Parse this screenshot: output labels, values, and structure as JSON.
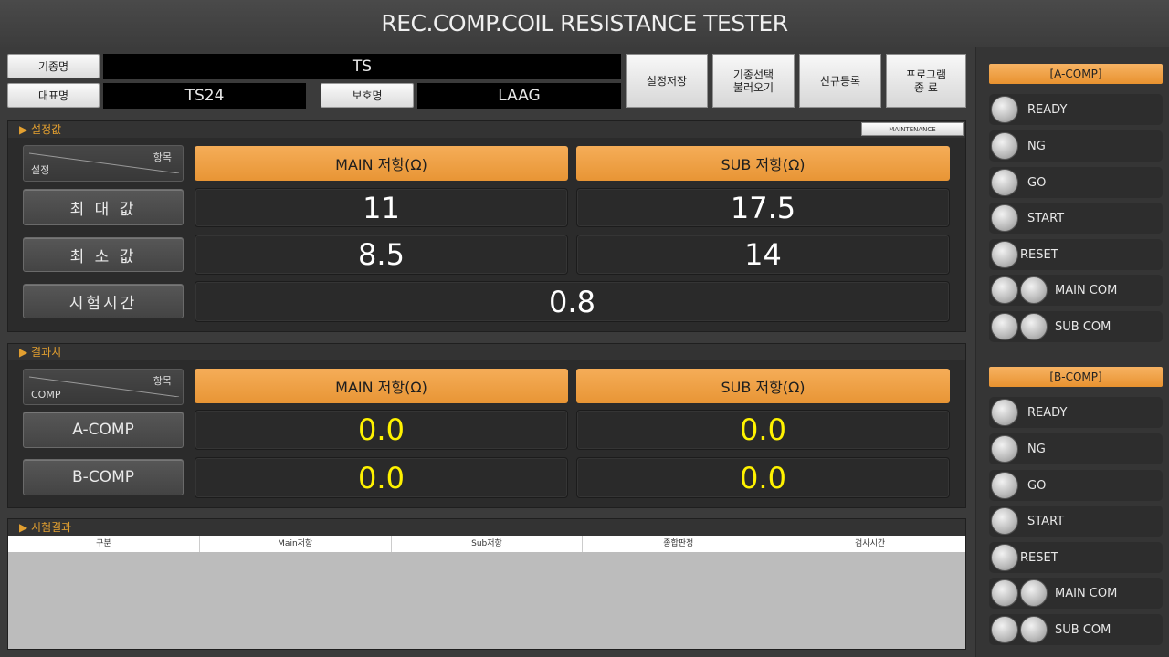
{
  "window": {
    "title": "REC.COMP.COIL RESISTANCE TESTER"
  },
  "header": {
    "model_label": "기종명",
    "model_value": "TS",
    "rep_label": "대표명",
    "rep_value": "TS24",
    "protect_label": "보호명",
    "protect_value": "LAAG"
  },
  "toolbar": {
    "save_settings": "설정저장",
    "load_model_line1": "기종선택",
    "load_model_line2": "불러오기",
    "new_register": "신규등록",
    "exit_line1": "프로그램",
    "exit_line2": "종    료"
  },
  "settings": {
    "section_title": "▶ 설정값",
    "small_button": "MAINTENANCE",
    "corner_top": "항목",
    "corner_bottom": "설정",
    "col_main": "MAIN 저항(Ω)",
    "col_sub": "SUB 저항(Ω)",
    "rows": [
      {
        "label": "최 대 값",
        "main": "11",
        "sub": "17.5"
      },
      {
        "label": "최 소 값",
        "main": "8.5",
        "sub": "14"
      }
    ],
    "time_label": "시험시간",
    "time_value": "0.8"
  },
  "results": {
    "section_title": "▶ 결과치",
    "corner_top": "항목",
    "corner_bottom": "COMP",
    "col_main": "MAIN 저항(Ω)",
    "col_sub": "SUB 저항(Ω)",
    "rows": [
      {
        "label": "A-COMP",
        "main": "0.0",
        "sub": "0.0"
      },
      {
        "label": "B-COMP",
        "main": "0.0",
        "sub": "0.0"
      }
    ]
  },
  "log": {
    "section_title": "▶ 시험결과",
    "columns": [
      "구분",
      "Main저항",
      "Sub저항",
      "종합판정",
      "검사시간"
    ]
  },
  "sidebar": {
    "a_title": "[A-COMP]",
    "b_title": "[B-COMP]",
    "indicators": [
      "READY",
      "NG",
      "GO",
      "START",
      "RESET",
      "MAIN COM",
      "SUB COM"
    ]
  }
}
